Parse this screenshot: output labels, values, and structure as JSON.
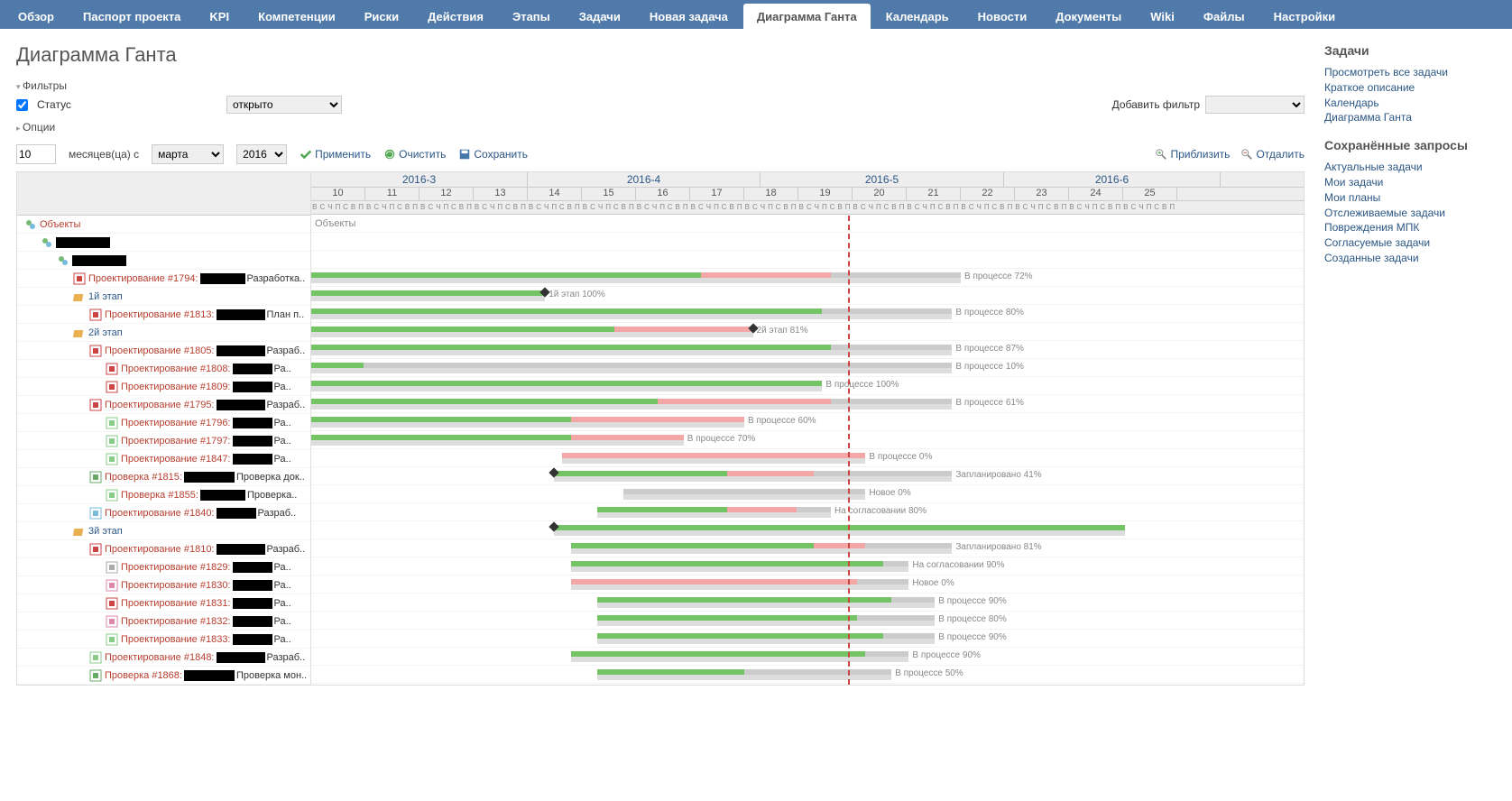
{
  "tabs": [
    "Обзор",
    "Паспорт проекта",
    "KPI",
    "Компетенции",
    "Риски",
    "Действия",
    "Этапы",
    "Задачи",
    "Новая задача",
    "Диаграмма Ганта",
    "Календарь",
    "Новости",
    "Документы",
    "Wiki",
    "Файлы",
    "Настройки"
  ],
  "active_tab": 9,
  "page_title": "Диаграмма Ганта",
  "filters": {
    "title": "Фильтры",
    "status_label": "Статус",
    "status_value": "открыто",
    "add_filter": "Добавить фильтр"
  },
  "options": {
    "title": "Опции"
  },
  "toolbar": {
    "months": "10",
    "months_label": "месяцев(ца) с",
    "month": "марта",
    "year": "2016",
    "apply": "Применить",
    "clear": "Очистить",
    "save": "Сохранить",
    "zoom_in": "Приблизить",
    "zoom_out": "Отдалить"
  },
  "sidebar": {
    "tasks_title": "Задачи",
    "task_links": [
      "Просмотреть все задачи",
      "Краткое описание",
      "Календарь",
      "Диаграмма Ганта"
    ],
    "queries_title": "Сохранённые запросы",
    "query_links": [
      "Актуальные задачи",
      "Мои задачи",
      "Мои планы",
      "Отслеживаемые задачи",
      "Повреждения МПК",
      "Согласуемые задачи",
      "Созданные задачи"
    ]
  },
  "timeline": {
    "months": [
      {
        "l": "2016-3",
        "w": 4
      },
      {
        "l": "2016-4",
        "w": 4.3
      },
      {
        "l": "2016-5",
        "w": 4.5
      },
      {
        "l": "2016-6",
        "w": 4
      }
    ],
    "weeks": [
      "10",
      "11",
      "12",
      "13",
      "14",
      "15",
      "16",
      "17",
      "18",
      "19",
      "20",
      "21",
      "22",
      "23",
      "24",
      "25"
    ],
    "day_labels": [
      "В",
      "С",
      "Ч",
      "П",
      "С",
      "В",
      "П"
    ],
    "root_label": "Объекты",
    "today_pct": 62
  },
  "rows": [
    {
      "indent": 0,
      "kind": "root",
      "text": "Объекты"
    },
    {
      "indent": 1,
      "kind": "proj",
      "text": "",
      "redact": 60
    },
    {
      "indent": 2,
      "kind": "proj",
      "text": "",
      "redact": 60
    },
    {
      "indent": 3,
      "kind": "task",
      "icon": "x",
      "link": "Проектирование #1794:",
      "redact": 50,
      "tail": "Разработка..",
      "bar": {
        "s": 0,
        "g": 45,
        "r": 15,
        "gr": 15
      },
      "label": "В процессе 72%"
    },
    {
      "indent": 3,
      "kind": "stage",
      "text": "1й этап",
      "bar": {
        "s": 0,
        "g": 27
      },
      "dia": 27,
      "label": "1й этап 100%"
    },
    {
      "indent": 4,
      "kind": "task",
      "icon": "x",
      "link": "Проектирование #1813:",
      "redact": 54,
      "tail": "План п..",
      "bar": {
        "s": 0,
        "g": 59,
        "gr": 15
      },
      "label": "В процессе 80%"
    },
    {
      "indent": 3,
      "kind": "stage",
      "text": "2й этап",
      "bar": {
        "s": 0,
        "g": 35,
        "r": 16
      },
      "dia": 51,
      "label": "2й этап 81%"
    },
    {
      "indent": 4,
      "kind": "task",
      "icon": "x",
      "link": "Проектирование #1805:",
      "redact": 54,
      "tail": "Разраб..",
      "bar": {
        "s": 0,
        "g": 60,
        "gr": 14
      },
      "label": "В процессе 87%"
    },
    {
      "indent": 5,
      "kind": "task",
      "icon": "x",
      "link": "Проектирование #1808:",
      "redact": 44,
      "tail": "Ра..",
      "bar": {
        "s": 0,
        "g": 6,
        "gr": 68
      },
      "label": "В процессе 10%"
    },
    {
      "indent": 5,
      "kind": "task",
      "icon": "x",
      "link": "Проектирование #1809:",
      "redact": 44,
      "tail": "Ра..",
      "bar": {
        "s": 0,
        "g": 59
      },
      "label": "В процессе 100%"
    },
    {
      "indent": 4,
      "kind": "task",
      "icon": "x",
      "link": "Проектирование #1795:",
      "redact": 54,
      "tail": "Разраб..",
      "bar": {
        "s": 0,
        "g": 40,
        "r": 20,
        "gr": 14
      },
      "label": "В процессе 61%"
    },
    {
      "indent": 5,
      "kind": "task",
      "icon": "o",
      "link": "Проектирование #1796:",
      "redact": 44,
      "tail": "Ра..",
      "bar": {
        "s": 0,
        "g": 30,
        "r": 20
      },
      "label": "В процессе 60%"
    },
    {
      "indent": 5,
      "kind": "task",
      "icon": "o",
      "link": "Проектирование #1797:",
      "redact": 44,
      "tail": "Ра..",
      "bar": {
        "s": 0,
        "g": 30,
        "r": 13
      },
      "label": "В процессе 70%"
    },
    {
      "indent": 5,
      "kind": "task",
      "icon": "o",
      "link": "Проектирование #1847:",
      "redact": 44,
      "tail": "Ра..",
      "bar": {
        "s": 29,
        "r": 35
      },
      "label": "В процессе 0%"
    },
    {
      "indent": 4,
      "kind": "task",
      "icon": "g",
      "link": "Проверка #1815:",
      "redact": 56,
      "tail": "Проверка док..",
      "bar": {
        "s": 28,
        "g": 20,
        "r": 10,
        "gr": 16
      },
      "dia": 28,
      "label": "Запланировано 41%"
    },
    {
      "indent": 5,
      "kind": "task",
      "icon": "o",
      "link": "Проверка #1855:",
      "redact": 50,
      "tail": "Проверка..",
      "bar": {
        "s": 36,
        "gr": 28
      },
      "label": "Новое 0%"
    },
    {
      "indent": 4,
      "kind": "task",
      "icon": "b",
      "link": "Проектирование #1840:",
      "redact": 44,
      "tail": "Разраб..",
      "bar": {
        "s": 33,
        "g": 15,
        "r": 8,
        "gr": 4
      },
      "label": "На согласовании 80%"
    },
    {
      "indent": 3,
      "kind": "stage",
      "text": "3й этап",
      "dia": 28,
      "bar": {
        "s": 28,
        "g": 66
      }
    },
    {
      "indent": 4,
      "kind": "task",
      "icon": "x",
      "link": "Проектирование #1810:",
      "redact": 54,
      "tail": "Разраб..",
      "bar": {
        "s": 30,
        "g": 28,
        "r": 6,
        "gr": 10
      },
      "label": "Запланировано 81%"
    },
    {
      "indent": 5,
      "kind": "task",
      "icon": "gr",
      "link": "Проектирование #1829:",
      "redact": 44,
      "tail": "Ра..",
      "bar": {
        "s": 30,
        "g": 36,
        "gr": 3
      },
      "label": "На согласовании 90%"
    },
    {
      "indent": 5,
      "kind": "task",
      "icon": "p",
      "link": "Проектирование #1830:",
      "redact": 44,
      "tail": "Ра..",
      "bar": {
        "s": 30,
        "r": 33,
        "gr": 6
      },
      "label": "Новое 0%"
    },
    {
      "indent": 5,
      "kind": "task",
      "icon": "x",
      "link": "Проектирование #1831:",
      "redact": 44,
      "tail": "Ра..",
      "bar": {
        "s": 33,
        "g": 34,
        "gr": 5
      },
      "label": "В процессе 90%"
    },
    {
      "indent": 5,
      "kind": "task",
      "icon": "p",
      "link": "Проектирование #1832:",
      "redact": 44,
      "tail": "Ра..",
      "bar": {
        "s": 33,
        "g": 30,
        "gr": 9
      },
      "label": "В процессе 80%"
    },
    {
      "indent": 5,
      "kind": "task",
      "icon": "o",
      "link": "Проектирование #1833:",
      "redact": 44,
      "tail": "Ра..",
      "bar": {
        "s": 33,
        "g": 33,
        "gr": 6
      },
      "label": "В процессе 90%"
    },
    {
      "indent": 4,
      "kind": "task",
      "icon": "o",
      "link": "Проектирование #1848:",
      "redact": 54,
      "tail": "Разраб..",
      "bar": {
        "s": 30,
        "g": 34,
        "gr": 5
      },
      "label": "В процессе 90%"
    },
    {
      "indent": 4,
      "kind": "task",
      "icon": "g",
      "link": "Проверка #1868:",
      "redact": 56,
      "tail": "Проверка мон..",
      "bar": {
        "s": 33,
        "g": 17,
        "gr": 17
      },
      "label": "В процессе 50%"
    }
  ]
}
